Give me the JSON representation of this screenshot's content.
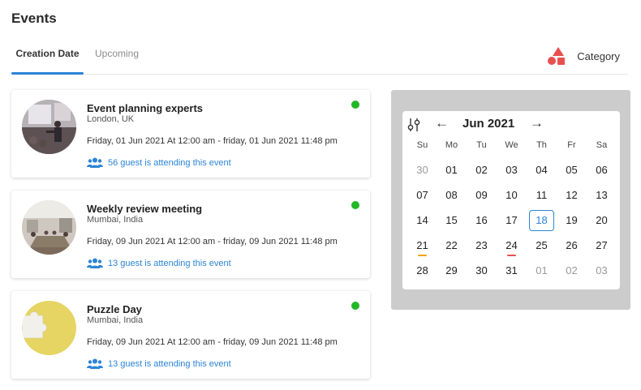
{
  "page": {
    "title": "Events"
  },
  "tabs": [
    {
      "label": "Creation Date",
      "active": true
    },
    {
      "label": "Upcoming",
      "active": false
    }
  ],
  "category": {
    "label": "Category",
    "icon": "shapes-icon",
    "color": "#e8504f"
  },
  "events": [
    {
      "title": "Event planning experts",
      "location": "London, UK",
      "time": "Friday, 01 Jun 2021 At 12:00 am - friday, 01 Jun 2021 11:48 pm",
      "attending": "56 guest is attending this event",
      "status_color": "#22b726"
    },
    {
      "title": "Weekly review meeting",
      "location": "Mumbai, India",
      "time": "Friday, 09 Jun 2021 At 12:00 am - friday, 09 Jun 2021 11:48 pm",
      "attending": "13 guest is attending this event",
      "status_color": "#22b726"
    },
    {
      "title": "Puzzle Day",
      "location": "Mumbai, India",
      "time": "Friday, 09 Jun 2021 At 12:00 am - friday, 09 Jun 2021 11:48 pm",
      "attending": "13 guest is attending this event",
      "status_color": "#22b726"
    }
  ],
  "calendar": {
    "month_label": "Jun 2021",
    "prev_icon": "arrow-left-icon",
    "next_icon": "arrow-right-icon",
    "weekdays": [
      "Su",
      "Mo",
      "Tu",
      "We",
      "Th",
      "Fr",
      "Sa"
    ],
    "weeks": [
      [
        "30",
        "01",
        "02",
        "03",
        "04",
        "05",
        "06"
      ],
      [
        "07",
        "08",
        "09",
        "10",
        "11",
        "12",
        "13"
      ],
      [
        "14",
        "15",
        "16",
        "17",
        "18",
        "19",
        "20"
      ],
      [
        "21",
        "22",
        "23",
        "24",
        "25",
        "26",
        "27"
      ],
      [
        "28",
        "29",
        "30",
        "31",
        "01",
        "02",
        "03"
      ]
    ],
    "muted": [
      [
        0,
        0
      ],
      [
        4,
        4
      ],
      [
        4,
        5
      ],
      [
        4,
        6
      ]
    ],
    "today": "18",
    "marks": [
      {
        "day": "21",
        "color": "#f0a500"
      },
      {
        "day": "24",
        "color": "#e8504f"
      }
    ],
    "accent": "#2c84d6"
  }
}
